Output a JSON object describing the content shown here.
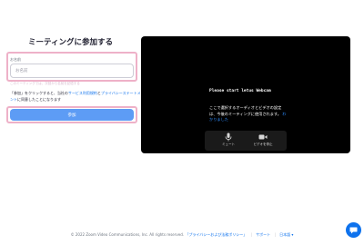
{
  "join_form": {
    "title": "ミーティングに参加する",
    "name_label": "お名前",
    "name_placeholder": "お名前",
    "name_value": "",
    "hint_text": "このミーティングでは、次回から名前を記憶する",
    "terms_part1": "「参加」をクリックすると、当社の",
    "terms_link1": "サービス利用規約",
    "terms_part2": "と",
    "terms_link2": "プライバシーステートメント",
    "terms_part3": "に同意したことになります",
    "join_button_label": "参加"
  },
  "preview": {
    "heading": "Please start letus Webcam",
    "message": "ここで選択するオーディオとビデオの設定は、今後のミーティングに使用されます。",
    "message_link": "わかりました",
    "mute_label": "ミュート",
    "video_label": "ビデオを停止"
  },
  "footer": {
    "copyright": "© 2022 Zoom Video Communications, Inc. All rights reserved.",
    "privacy_link": "「プライバシーおよび法務ポリシー」",
    "support_link": "サポート",
    "language_link": "日本語 ▾"
  },
  "colors": {
    "accent": "#0e72ed",
    "join_button": "#5d9cf5",
    "highlight": "#eeb1c8"
  },
  "icons": {
    "mute": "microphone-icon",
    "video": "video-camera-icon",
    "chat": "chat-bubble-icon"
  }
}
